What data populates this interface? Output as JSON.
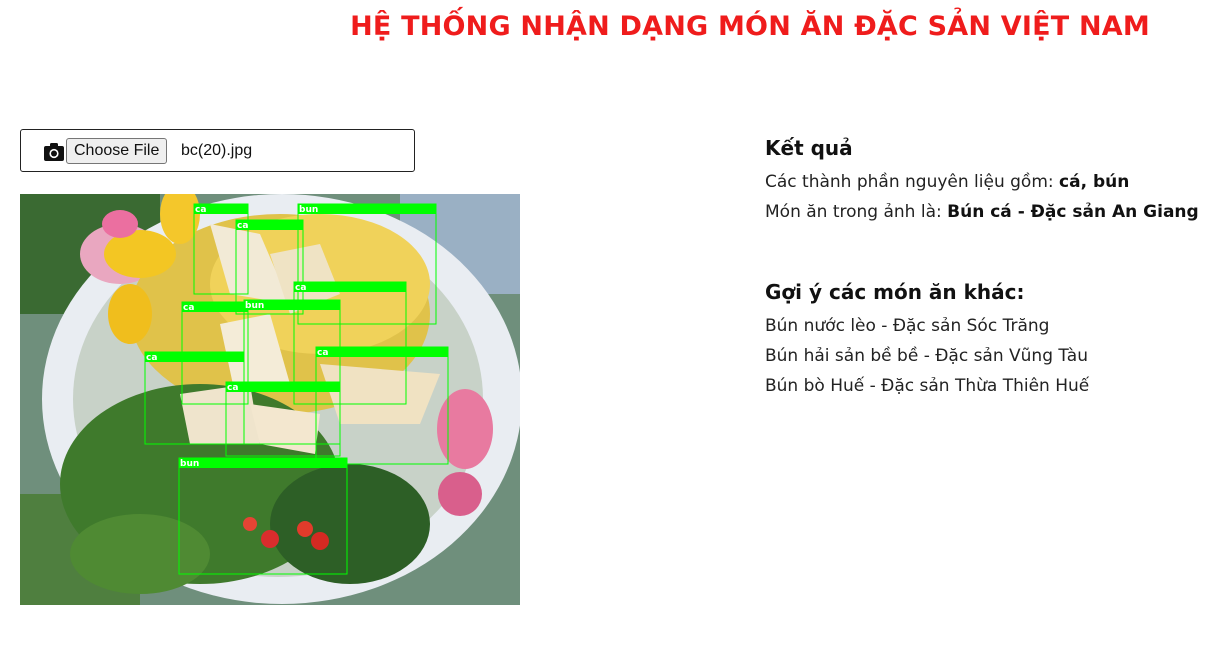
{
  "header": {
    "title": "HỆ THỐNG NHẬN DẠNG MÓN ĂN ĐẶC SẢN VIỆT NAM"
  },
  "upload": {
    "icon": "camera-icon",
    "button_label": "Choose File",
    "file_name": "bc(20).jpg"
  },
  "image": {
    "detections": [
      {
        "label": "ca"
      },
      {
        "label": "bun"
      },
      {
        "label": "ca"
      },
      {
        "label": "ca"
      },
      {
        "label": "ca"
      },
      {
        "label": "bun"
      },
      {
        "label": "ca"
      },
      {
        "label": "ca"
      },
      {
        "label": "ca"
      },
      {
        "label": "bun"
      }
    ]
  },
  "result": {
    "heading": "Kết quả",
    "ingredients_label": "Các thành phần nguyên liệu gồm: ",
    "ingredients_value": "cá, bún",
    "dish_label": "Món ăn trong ảnh là: ",
    "dish_value": "Bún cá - Đặc sản An Giang"
  },
  "suggestions": {
    "heading": "Gợi ý các món ăn khác:",
    "items": [
      "Bún nước lèo - Đặc sản Sóc Trăng",
      "Bún hải sản bề bề - Đặc sản Vũng Tàu",
      "Bún bò Huế - Đặc sản Thừa Thiên Huế"
    ]
  },
  "colors": {
    "title": "#ef1c1c",
    "box": "#00ff00"
  }
}
